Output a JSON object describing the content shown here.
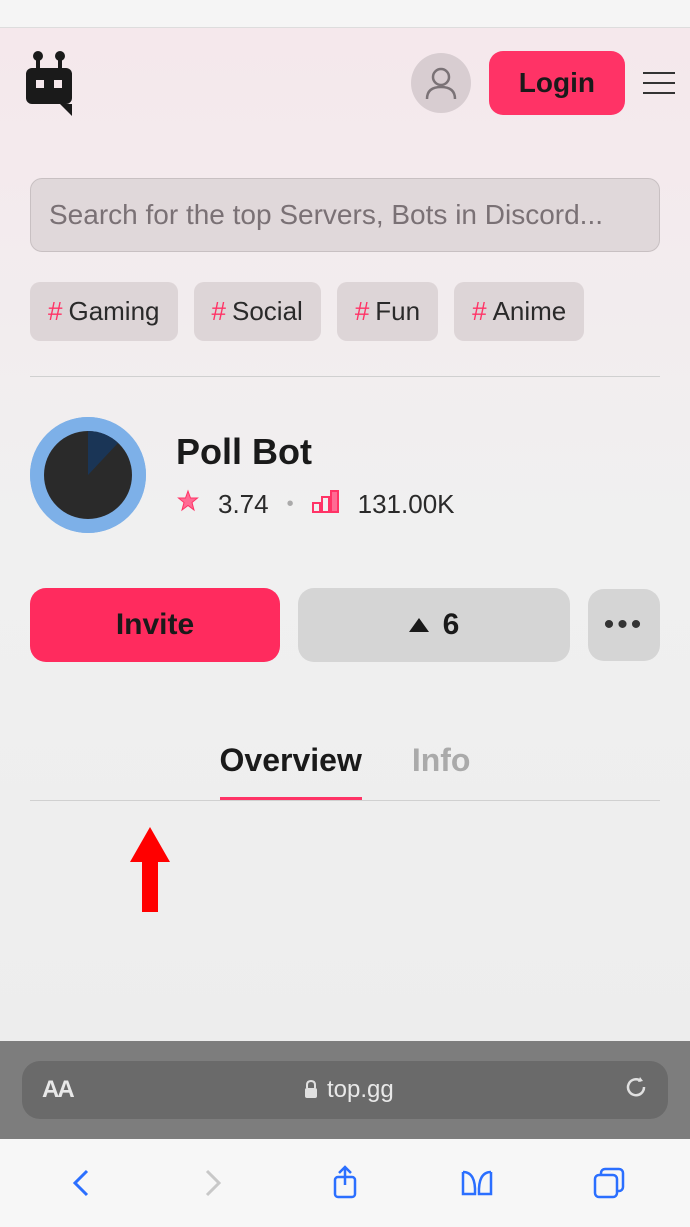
{
  "header": {
    "login_label": "Login"
  },
  "search": {
    "placeholder": "Search for the top Servers, Bots in Discord..."
  },
  "tags": [
    {
      "label": "Gaming"
    },
    {
      "label": "Social"
    },
    {
      "label": "Fun"
    },
    {
      "label": "Anime"
    }
  ],
  "bot": {
    "name": "Poll Bot",
    "rating": "3.74",
    "servers": "131.00K"
  },
  "actions": {
    "invite_label": "Invite",
    "vote_count": "6"
  },
  "tabs": {
    "overview": "Overview",
    "info": "Info"
  },
  "browser": {
    "url": "top.gg"
  }
}
